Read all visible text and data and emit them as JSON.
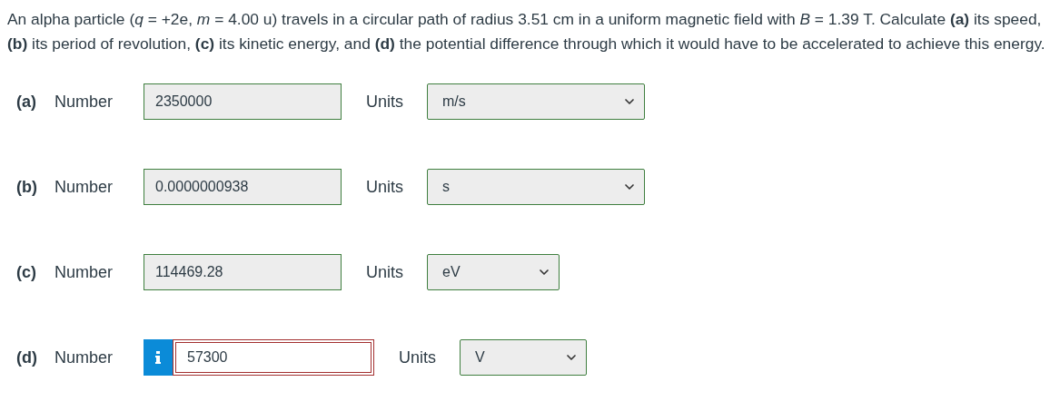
{
  "question": "An alpha particle (*q* = +2e, *m* = 4.00 u) travels in a circular path of radius 3.51 cm in a uniform magnetic field with *B* = 1.39 T. Calculate **(a)** its speed, **(b)** its period of revolution, **(c)** its kinetic energy, and **(d)** the potential difference through which it would have to be accelerated to achieve this energy.",
  "parts": [
    {
      "label": "(a)",
      "field_label": "Number",
      "value": "2350000",
      "correct": true,
      "info": false,
      "units_label": "Units",
      "unit": "m/s"
    },
    {
      "label": "(b)",
      "field_label": "Number",
      "value": "0.0000000938",
      "correct": true,
      "info": false,
      "units_label": "Units",
      "unit": "s"
    },
    {
      "label": "(c)",
      "field_label": "Number",
      "value": "114469.28",
      "correct": true,
      "info": false,
      "units_label": "Units",
      "unit": "eV"
    },
    {
      "label": "(d)",
      "field_label": "Number",
      "value": "57300",
      "correct": false,
      "info": true,
      "units_label": "Units",
      "unit": "V"
    }
  ]
}
